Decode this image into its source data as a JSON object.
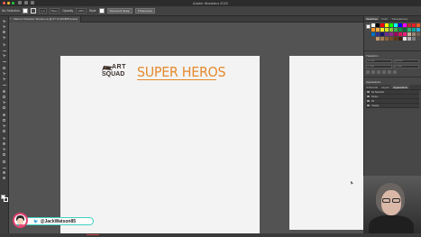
{
  "window": {
    "app_title": "Adobe Illustrator 2022"
  },
  "controlbar": {
    "selection_label": "No Selection",
    "stroke_weight": "1 pt",
    "stroke_style": "Basic",
    "opacity_label": "Opacity",
    "opacity_value": "100%",
    "style_label": "Style",
    "doc_setup_button": "Document Setup",
    "preferences_button": "Preferences"
  },
  "document": {
    "tab_title": "Mascot Character Streams.ai @ 67 % (RGB/Preview)"
  },
  "artboard": {
    "logo_art": "ART",
    "logo_squad": "SQUAD",
    "logo_title": "SUPER HEROS"
  },
  "panel": {
    "tabs": [
      "Swatches",
      "Color",
      "Transparency"
    ],
    "section_transform": "Transform",
    "x_label": "X: 0 in",
    "y_label": "Y: 0 in",
    "w_label": "W: 0 in",
    "h_label": "H: 0 in",
    "section_appearance": "Appearance",
    "layers_tabs": [
      "Artboards",
      "Layers",
      "Appearance"
    ],
    "layer_rows": [
      "No Selection",
      "Stroke",
      "Fill",
      "Opacity"
    ]
  },
  "swatch_colors": [
    "#ffffff",
    "#000000",
    "#ff0000",
    "#ffff00",
    "#00ff00",
    "#00ffff",
    "#0000ff",
    "#ff00ff",
    "#c1272d",
    "#ed1c24",
    "#f15a24",
    "#f7931e",
    "#fbb03b",
    "#fcee21",
    "#d9e021",
    "#8cc63f",
    "#39b54a",
    "#009245",
    "#006837",
    "#22b573",
    "#00a99d",
    "#29abe2",
    "#0071bc",
    "#2e3192",
    "#1b1464",
    "#662d91",
    "#93278f",
    "#9e005d",
    "#d4145a",
    "#ed1e79",
    "#c7b299",
    "#998675",
    "#736357",
    "#534741",
    "#c69c6d",
    "#a67c52",
    "#8c6239",
    "#754c24",
    "#603813",
    "#42210b",
    "#e6e6e6",
    "#b3b3b3",
    "#808080",
    "#4d4d4d"
  ],
  "streamer": {
    "handle": "@JackWatson85",
    "social_icon": "twitter-bird"
  },
  "colors": {
    "accent_orange": "#e48a2e",
    "logo_dark": "#3a2e2a",
    "badge_border": "#3fd0c0",
    "badge_avatar_ring": "#e6416e"
  }
}
